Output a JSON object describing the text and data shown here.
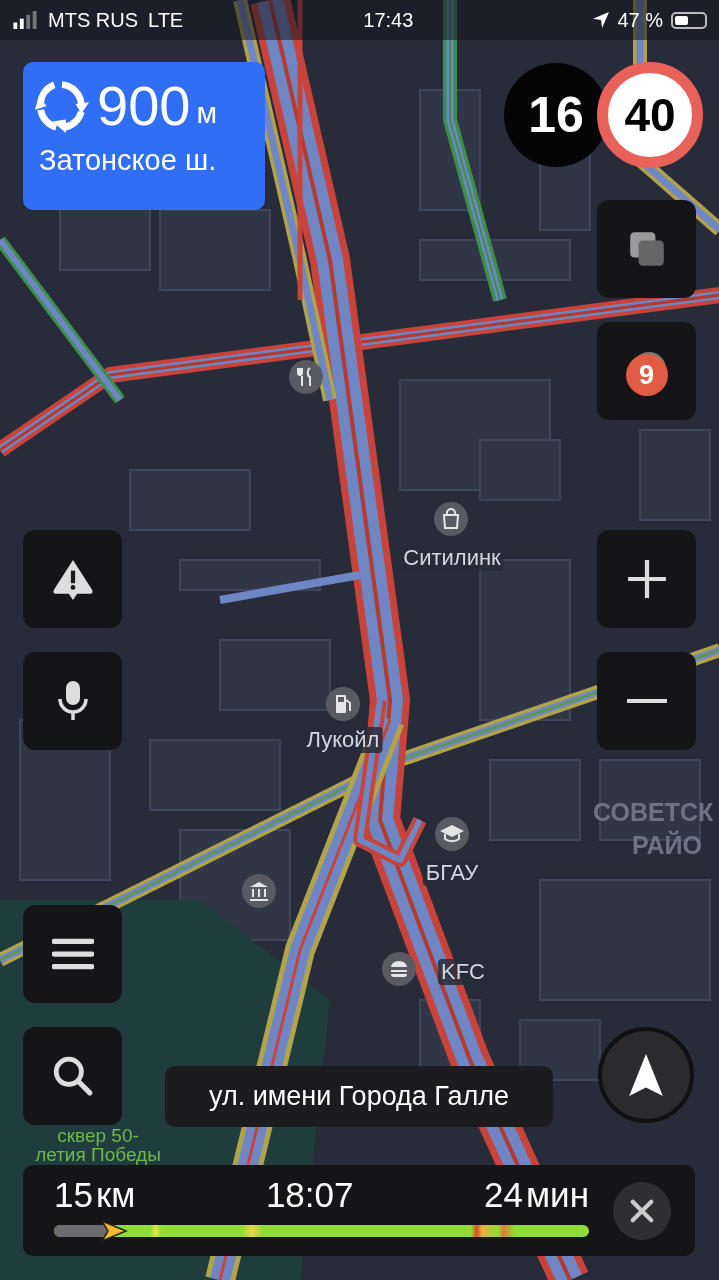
{
  "status_bar": {
    "carrier": "MTS RUS",
    "network": "LTE",
    "time": "17:43",
    "battery": "47 %"
  },
  "maneuver": {
    "distance": "900",
    "unit": "м",
    "street": "Затонское ш."
  },
  "speed": {
    "current": "16",
    "limit": "40"
  },
  "traffic": {
    "score": "9"
  },
  "map_labels": [
    {
      "kind": "shop",
      "text": "Ситилинк"
    },
    {
      "kind": "fuel",
      "text": "Лукойл"
    },
    {
      "kind": "education",
      "text": "БГАУ"
    },
    {
      "kind": "fastfood",
      "text": "KFC"
    },
    {
      "kind": "district",
      "text": "СОВЕТСК"
    },
    {
      "kind": "district",
      "text": "РАЙО"
    },
    {
      "kind": "park",
      "text": "сквер 50-"
    },
    {
      "kind": "park",
      "text": "летия Победы"
    }
  ],
  "current_street": "ул. имени Города Галле",
  "route": {
    "distance": "15",
    "distance_unit": "км",
    "arrival": "18:07",
    "duration": "24",
    "duration_unit": "мин",
    "level": 0.1
  }
}
